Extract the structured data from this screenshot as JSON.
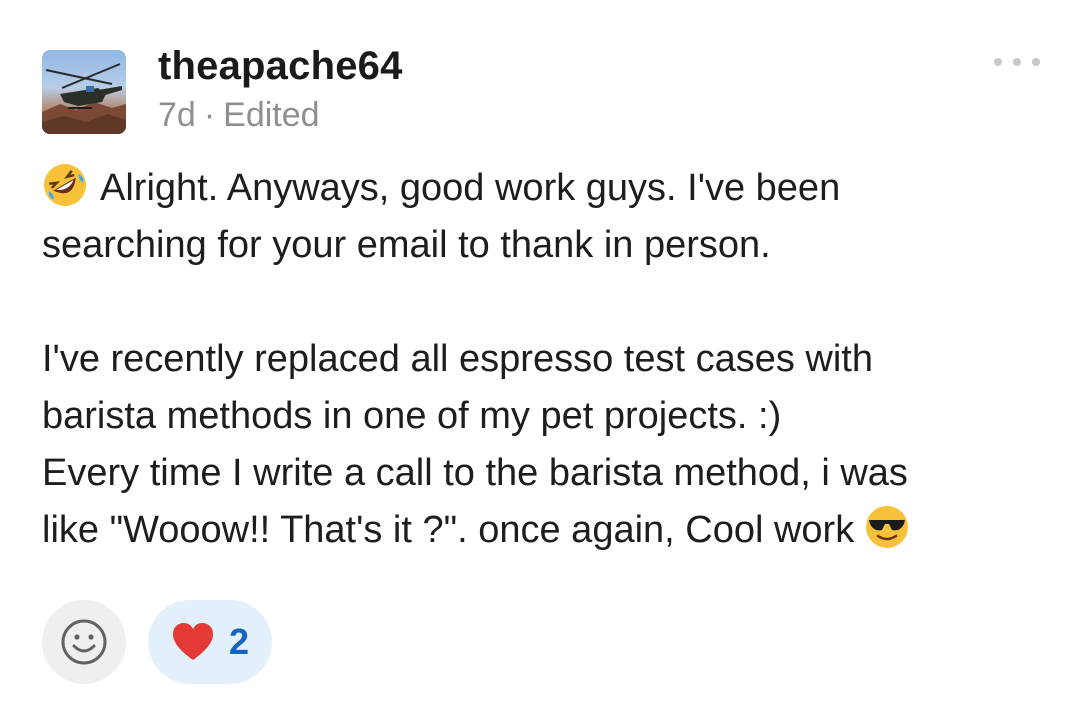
{
  "post": {
    "author": "theapache64",
    "age": "7d",
    "separator": "·",
    "edited_label": "Edited",
    "lines": [
      "Alright. Anyways, good work guys. I've been",
      "searching for your email to thank in person.",
      "",
      "I've recently replaced all espresso test cases with",
      "barista methods in one of my pet projects. :)",
      "Every time I write a call to the barista method, i was",
      "like \"Wooow!! That's it ?\". once again, Cool work"
    ]
  },
  "icons": {
    "more": "more-horizontal-icon",
    "leading_emoji": "rofl-emoji",
    "trailing_emoji": "sunglasses-emoji",
    "add_reaction": "smiley-icon",
    "reaction": "heart-icon"
  },
  "reactions": [
    {
      "emoji": "heart",
      "count": "2"
    }
  ],
  "colors": {
    "meta": "#8e8e93",
    "reaction_bg": "#e3effb",
    "reaction_count": "#1565c0",
    "add_reaction_bg": "#efeff2",
    "heart": "#e53935"
  }
}
